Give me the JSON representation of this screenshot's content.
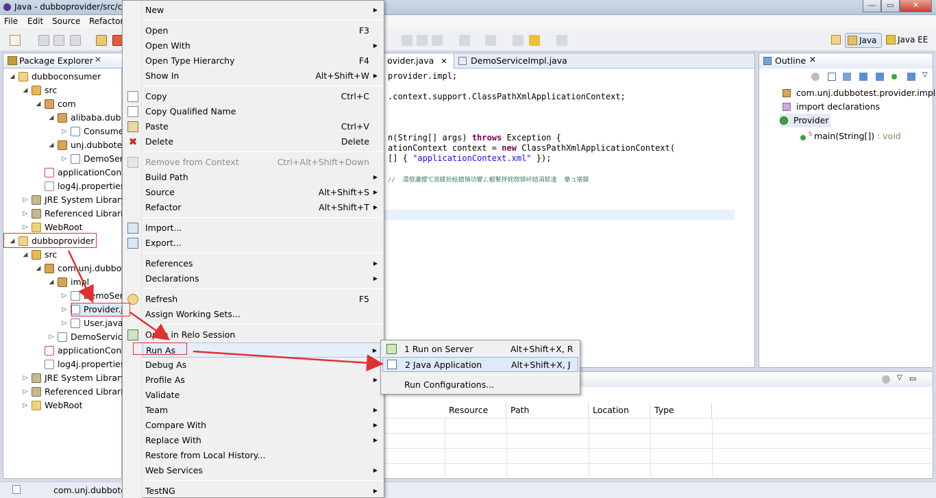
{
  "window": {
    "title": "Java - dubboprovider/src/c",
    "min": "—",
    "max": "▭",
    "close": "✕"
  },
  "menubar": [
    "File",
    "Edit",
    "Source",
    "Refactor"
  ],
  "perspectives": {
    "java": "Java",
    "javaee": "Java EE"
  },
  "package_explorer": {
    "tab": "Package Explorer",
    "close": "✕",
    "nodes": [
      "dubboconsumer",
      "src",
      "com",
      "alibaba.dub",
      "Consume",
      "unj.dubbote",
      "DemoSer",
      "applicationCont",
      "log4j.properties",
      "JRE System Library",
      "Referenced Librari",
      "WebRoot",
      "dubboprovider",
      "src",
      "com.unj.dubbot",
      "impl",
      "DemoSer",
      "Provider.j",
      "User.java",
      "DemoServic",
      "applicationCont",
      "log4j.properties",
      "JRE System Library",
      "Referenced Librari",
      "WebRoot"
    ]
  },
  "editor": {
    "tabs": [
      "ovider.java",
      "DemoServiceImpl.java"
    ],
    "lines": {
      "l1": "provider.impl;",
      "l2": ".context.support.ClassPathXmlApplicationContext;",
      "l3a": "n(String[] args) ",
      "l3kw": "throws",
      "l3b": " Exception {",
      "l4a": "ationContext context = ",
      "l4kw": "new",
      "l4b": " ClassPathXmlApplicationContext(",
      "l5a": "[] { ",
      "l5str": "\"applicationContext.xml\"",
      "l5b": " });",
      "l6": "//  濡傛灉娌℃湁鍒扮紶鎴愪功鐢ㄥ嚭鐜拌姹傚锛屽姞涓婃湰  搴ュ垎鎵"
    }
  },
  "outline": {
    "tab": "Outline",
    "close": "✕",
    "nodes": [
      "com.unj.dubbotest.provider.impl",
      "import declarations",
      "Provider",
      "main(String[])",
      " : void"
    ],
    "static_mark": "S"
  },
  "bottom": {
    "columns": [
      "Resource",
      "Path",
      "Location",
      "Type"
    ]
  },
  "status": "com.unj.dubbote",
  "context_menu": {
    "items": [
      {
        "label": "New",
        "acc": "",
        "sub": true
      },
      {
        "label": "Open",
        "acc": "F3"
      },
      {
        "label": "Open With",
        "acc": "",
        "sub": true
      },
      {
        "label": "Open Type Hierarchy",
        "acc": "F4"
      },
      {
        "label": "Show In",
        "acc": "Alt+Shift+W",
        "sub": true
      },
      {
        "label": "Copy",
        "acc": "Ctrl+C"
      },
      {
        "label": "Copy Qualified Name",
        "acc": ""
      },
      {
        "label": "Paste",
        "acc": "Ctrl+V"
      },
      {
        "label": "Delete",
        "acc": "Delete"
      },
      {
        "label": "Remove from Context",
        "acc": "Ctrl+Alt+Shift+Down",
        "disabled": true
      },
      {
        "label": "Build Path",
        "acc": "",
        "sub": true
      },
      {
        "label": "Source",
        "acc": "Alt+Shift+S",
        "sub": true
      },
      {
        "label": "Refactor",
        "acc": "Alt+Shift+T",
        "sub": true
      },
      {
        "label": "Import...",
        "acc": ""
      },
      {
        "label": "Export...",
        "acc": ""
      },
      {
        "label": "References",
        "acc": "",
        "sub": true
      },
      {
        "label": "Declarations",
        "acc": "",
        "sub": true
      },
      {
        "label": "Refresh",
        "acc": "F5"
      },
      {
        "label": "Assign Working Sets...",
        "acc": ""
      },
      {
        "label": "Open in Relo Session",
        "acc": ""
      },
      {
        "label": "Run As",
        "acc": "",
        "sub": true
      },
      {
        "label": "Debug As",
        "acc": "",
        "sub": true
      },
      {
        "label": "Profile As",
        "acc": "",
        "sub": true
      },
      {
        "label": "Validate",
        "acc": ""
      },
      {
        "label": "Team",
        "acc": "",
        "sub": true
      },
      {
        "label": "Compare With",
        "acc": "",
        "sub": true
      },
      {
        "label": "Replace With",
        "acc": "",
        "sub": true
      },
      {
        "label": "Restore from Local History...",
        "acc": ""
      },
      {
        "label": "Web Services",
        "acc": "",
        "sub": true
      },
      {
        "label": "TestNG",
        "acc": "",
        "sub": true
      }
    ]
  },
  "run_as_menu": {
    "items": [
      {
        "label": "1 Run on Server",
        "acc": "Alt+Shift+X, R"
      },
      {
        "label": "2 Java Application",
        "acc": "Alt+Shift+X, J"
      },
      {
        "label": "Run Configurations...",
        "acc": ""
      }
    ]
  },
  "colors": {
    "annotation_red": "#e03030",
    "keyword": "#7f0055",
    "string": "#2a00ff"
  }
}
